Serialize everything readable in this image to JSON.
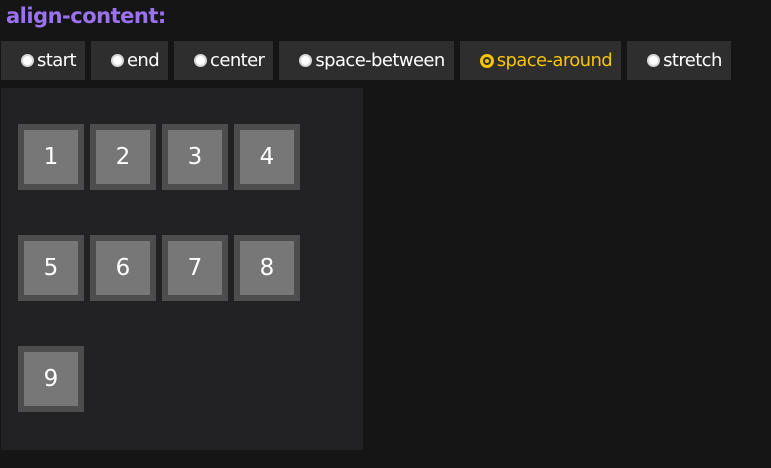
{
  "title": "align-content:",
  "options": [
    {
      "label": "start",
      "selected": false
    },
    {
      "label": "end",
      "selected": false
    },
    {
      "label": "center",
      "selected": false
    },
    {
      "label": "space-between",
      "selected": false
    },
    {
      "label": "space-around",
      "selected": true
    },
    {
      "label": "stretch",
      "selected": false
    }
  ],
  "items": [
    "1",
    "2",
    "3",
    "4",
    "5",
    "6",
    "7",
    "8",
    "9"
  ],
  "colors": {
    "title": "#9a72ee",
    "selected": "#f7c400",
    "background": "#151515",
    "button": "#2e2e2e",
    "container": "#222224",
    "item_border": "#4d4d4d",
    "item_face": "#777777"
  }
}
